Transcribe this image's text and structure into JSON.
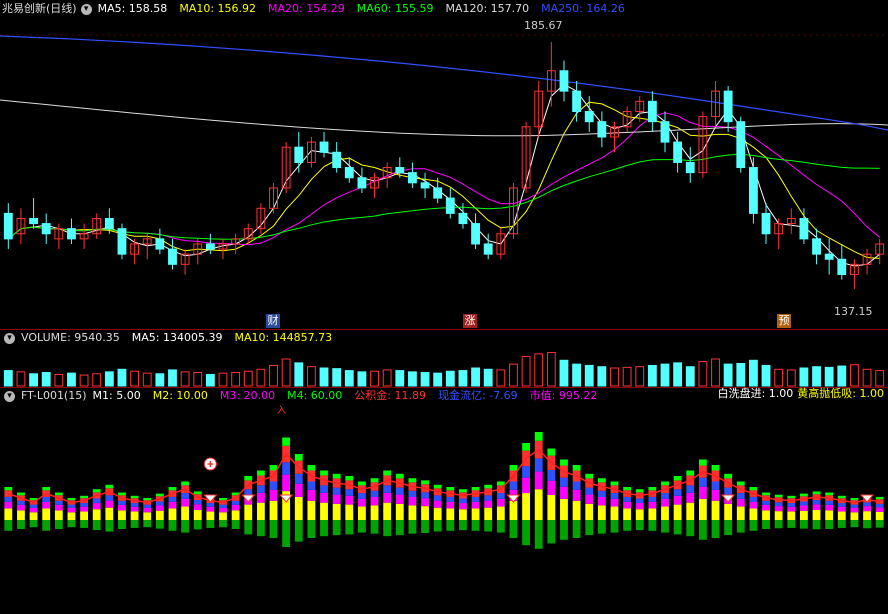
{
  "stock": {
    "name": "兆易创新",
    "period": "(日线)",
    "title": "兆易创新(日线)"
  },
  "ma_legend": [
    {
      "label": "MA5: 158.58",
      "color": "#ffffff"
    },
    {
      "label": "MA10: 156.92",
      "color": "#ffff00"
    },
    {
      "label": "MA20: 154.29",
      "color": "#ff00ff"
    },
    {
      "label": "MA60: 155.59",
      "color": "#00ff00"
    },
    {
      "label": "MA120: 157.70",
      "color": "#dddddd"
    },
    {
      "label": "MA250: 164.26",
      "color": "#3050ff"
    }
  ],
  "price_marks": {
    "high": "185.67",
    "low": "137.15"
  },
  "events": [
    {
      "text": "财",
      "color": "#3060c0"
    },
    {
      "text": "涨",
      "color": "#c03030"
    },
    {
      "text": "预",
      "color": "#c07020"
    }
  ],
  "volume_legend": [
    {
      "label": "VOLUME: 9540.35",
      "color": "#dddddd"
    },
    {
      "label": "MA5: 134005.39",
      "color": "#ffffff"
    },
    {
      "label": "MA10: 144857.73",
      "color": "#ffff00"
    }
  ],
  "indicator_legend": {
    "name": "FT-L001(15)",
    "items": [
      {
        "label": "M1: 5.00",
        "color": "#ffffff"
      },
      {
        "label": "M2: 10.00",
        "color": "#ffff00"
      },
      {
        "label": "M3: 20.00",
        "color": "#ff00ff"
      },
      {
        "label": "M4: 60.00",
        "color": "#00ff00"
      },
      {
        "label": "公积金: 11.89",
        "color": "#ff3030"
      },
      {
        "label": "现金流亿: -7.69",
        "color": "#3050ff"
      },
      {
        "label": "市值: 995.22",
        "color": "#ff00ff"
      }
    ],
    "right_items": [
      {
        "label": "白洗盘进: 1.00",
        "color": "#ffffff"
      },
      {
        "label": "黄高抛低吸: 1.00",
        "color": "#ffff00"
      }
    ]
  },
  "indicator_marker": {
    "text": "入"
  },
  "colors": {
    "up": "#ff3232",
    "down": "#54ffff",
    "bg": "#000000",
    "grid": "#8b0000",
    "ma5": "#ffffff",
    "ma10": "#ffff00",
    "ma20": "#ff00ff",
    "ma60": "#00ff00",
    "ma120": "#dddddd",
    "ma250": "#3050ff"
  },
  "chart_data": {
    "type": "candlestick",
    "price_range": [
      137.15,
      185.67
    ],
    "volume_range": [
      0,
      280000
    ],
    "candles_ohlc": [
      [
        152,
        154,
        145,
        147
      ],
      [
        148,
        153,
        146,
        151
      ],
      [
        151,
        155,
        149,
        150
      ],
      [
        150,
        152,
        146,
        148
      ],
      [
        147,
        150,
        145,
        149
      ],
      [
        149,
        151,
        146,
        147
      ],
      [
        147,
        150,
        145,
        148
      ],
      [
        148,
        152,
        147,
        151
      ],
      [
        151,
        153,
        148,
        149
      ],
      [
        149,
        150,
        143,
        144
      ],
      [
        144,
        147,
        142,
        146
      ],
      [
        146,
        148,
        143,
        147
      ],
      [
        147,
        149,
        144,
        145
      ],
      [
        145,
        147,
        141,
        142
      ],
      [
        142,
        145,
        140,
        144
      ],
      [
        144,
        147,
        142,
        146
      ],
      [
        146,
        148,
        144,
        145
      ],
      [
        145,
        147,
        143,
        146
      ],
      [
        146,
        148,
        144,
        147
      ],
      [
        147,
        150,
        146,
        149
      ],
      [
        149,
        154,
        148,
        153
      ],
      [
        153,
        158,
        152,
        157
      ],
      [
        157,
        166,
        156,
        165
      ],
      [
        165,
        168,
        160,
        162
      ],
      [
        162,
        167,
        161,
        166
      ],
      [
        166,
        168,
        163,
        164
      ],
      [
        164,
        166,
        160,
        161
      ],
      [
        161,
        163,
        158,
        159
      ],
      [
        159,
        161,
        156,
        157
      ],
      [
        157,
        160,
        155,
        159
      ],
      [
        159,
        162,
        157,
        161
      ],
      [
        161,
        163,
        159,
        160
      ],
      [
        160,
        162,
        157,
        158
      ],
      [
        158,
        160,
        155,
        157
      ],
      [
        157,
        159,
        154,
        155
      ],
      [
        155,
        157,
        151,
        152
      ],
      [
        152,
        154,
        149,
        150
      ],
      [
        150,
        152,
        145,
        146
      ],
      [
        146,
        148,
        143,
        144
      ],
      [
        144,
        149,
        143,
        148
      ],
      [
        148,
        158,
        147,
        157
      ],
      [
        157,
        170,
        156,
        169
      ],
      [
        169,
        178,
        167,
        176
      ],
      [
        176,
        185.67,
        173,
        180
      ],
      [
        180,
        182,
        174,
        176
      ],
      [
        176,
        178,
        170,
        172
      ],
      [
        172,
        175,
        168,
        170
      ],
      [
        170,
        172,
        165,
        167
      ],
      [
        167,
        170,
        164,
        169
      ],
      [
        169,
        173,
        168,
        172
      ],
      [
        172,
        175,
        170,
        174
      ],
      [
        174,
        176,
        168,
        170
      ],
      [
        170,
        172,
        164,
        166
      ],
      [
        166,
        168,
        160,
        162
      ],
      [
        162,
        165,
        158,
        160
      ],
      [
        160,
        172,
        159,
        171
      ],
      [
        171,
        178,
        169,
        176
      ],
      [
        176,
        177,
        168,
        170
      ],
      [
        170,
        171,
        160,
        161
      ],
      [
        161,
        163,
        150,
        152
      ],
      [
        152,
        154,
        146,
        148
      ],
      [
        148,
        151,
        145,
        150
      ],
      [
        150,
        153,
        148,
        151
      ],
      [
        151,
        153,
        146,
        147
      ],
      [
        147,
        149,
        142,
        144
      ],
      [
        144,
        147,
        140,
        143
      ],
      [
        143,
        146,
        139,
        140
      ],
      [
        140,
        143,
        137.15,
        142
      ],
      [
        142,
        145,
        140,
        144
      ],
      [
        144,
        147,
        142,
        146
      ]
    ],
    "volume": [
      120000,
      110000,
      95000,
      105000,
      90000,
      100000,
      85000,
      95000,
      110000,
      130000,
      115000,
      100000,
      95000,
      125000,
      110000,
      105000,
      90000,
      100000,
      105000,
      115000,
      130000,
      160000,
      210000,
      180000,
      150000,
      140000,
      135000,
      120000,
      110000,
      115000,
      125000,
      120000,
      110000,
      105000,
      100000,
      115000,
      120000,
      140000,
      130000,
      125000,
      170000,
      230000,
      250000,
      260000,
      200000,
      170000,
      160000,
      150000,
      140000,
      145000,
      150000,
      160000,
      170000,
      180000,
      150000,
      190000,
      210000,
      170000,
      175000,
      200000,
      160000,
      130000,
      125000,
      140000,
      150000,
      145000,
      155000,
      165000,
      130000,
      120000
    ],
    "indicator_bars": [
      3,
      2.5,
      2,
      3,
      2.5,
      2,
      2.2,
      2.8,
      3.2,
      2.5,
      2.2,
      2.0,
      2.4,
      3.0,
      3.5,
      2.6,
      2.2,
      2.0,
      2.5,
      4.0,
      4.5,
      5.0,
      7.5,
      6.0,
      5.0,
      4.5,
      4.2,
      4.0,
      3.5,
      3.8,
      4.5,
      4.2,
      3.8,
      3.6,
      3.2,
      3.0,
      2.8,
      3.0,
      3.2,
      3.5,
      5.0,
      7.0,
      8.0,
      6.5,
      5.5,
      5.0,
      4.2,
      3.8,
      3.5,
      3.0,
      2.8,
      3.0,
      3.5,
      4.0,
      4.5,
      5.5,
      5.0,
      4.2,
      3.5,
      3.0,
      2.5,
      2.3,
      2.2,
      2.4,
      2.6,
      2.5,
      2.2,
      2.0,
      2.3,
      2.1
    ],
    "title": "兆易创新(日线)"
  }
}
